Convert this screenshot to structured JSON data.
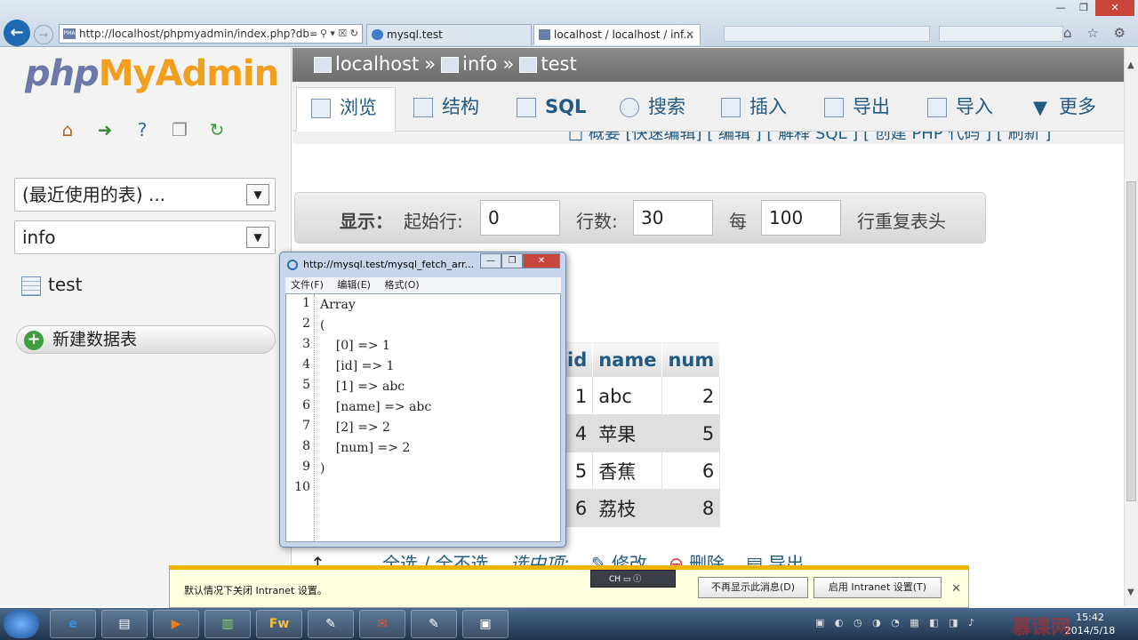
{
  "browser": {
    "address": "http://localhost/phpmyadmin/index.php?db=ir",
    "address_tools": "⚲ ▾ ☒ ↻",
    "tabs": [
      {
        "label": "mysql.test"
      },
      {
        "label": "localhost / localhost / inf...",
        "close": "✕"
      }
    ],
    "window_buttons": [
      "—",
      "❐",
      "✕"
    ],
    "icons": "⌂ ☆ ⚙"
  },
  "left": {
    "logo_php": "php",
    "logo_myadmin": "MyAdmin",
    "recent_select": "(最近使用的表) ...",
    "db_select": "info",
    "table_item": "test",
    "new_table": "新建数据表"
  },
  "main": {
    "breadcrumb": {
      "server": "localhost",
      "sep": "»",
      "db": "info",
      "table": "test"
    },
    "tabs": [
      "浏览",
      "结构",
      "SQL",
      "搜索",
      "插入",
      "导出",
      "导入",
      "更多"
    ],
    "subnav": "□ 概要 [快速编辑] [ 编辑 ] [ 解释 SQL ] [ 创建 PHP 代码 ] [ 刷新 ]",
    "display": {
      "show_label": "显示：",
      "start_label": "起始行:",
      "start_value": "0",
      "rows_label": "行数:",
      "rows_value": "30",
      "every_label": "每",
      "every_value": "100",
      "repeat_label": "行重复表头"
    },
    "table": {
      "headers": [
        "id",
        "name",
        "num"
      ],
      "rows": [
        [
          "1",
          "abc",
          "2"
        ],
        [
          "4",
          "苹果",
          "5"
        ],
        [
          "5",
          "香蕉",
          "6"
        ],
        [
          "6",
          "荔枝",
          "8"
        ]
      ]
    },
    "bottom": {
      "select_all": "全选 / 全不选",
      "selected": "选中项:",
      "edit": "修改",
      "delete": "删除",
      "export": "导出"
    }
  },
  "popup": {
    "title": "http://mysql.test/mysql_fetch_arr...",
    "menu": [
      "文件(F)",
      "编辑(E)",
      "格式(O)"
    ],
    "lines": [
      "Array",
      "(",
      "    [0] => 1",
      "    [id] => 1",
      "    [1] => abc",
      "    [name] => abc",
      "    [2] => 2",
      "    [num] => 2",
      ")",
      ""
    ],
    "line_numbers": [
      "1",
      "2",
      "3",
      "4",
      "5",
      "6",
      "7",
      "8",
      "9",
      "10"
    ]
  },
  "notification": {
    "text": "默认情况下关闭 Intranet 设置。",
    "dont_show": "不再显示此消息(D)",
    "enable": "启用 Intranet 设置(T)",
    "close": "✕",
    "ime": "CH"
  },
  "taskbar": {
    "apps": [
      "e",
      "▤",
      "▶",
      "▥",
      "Fw",
      "✎",
      "✉",
      "✎",
      "▣"
    ],
    "time": "15:42",
    "date": "2014/5/18",
    "watermark": "慕课网"
  }
}
